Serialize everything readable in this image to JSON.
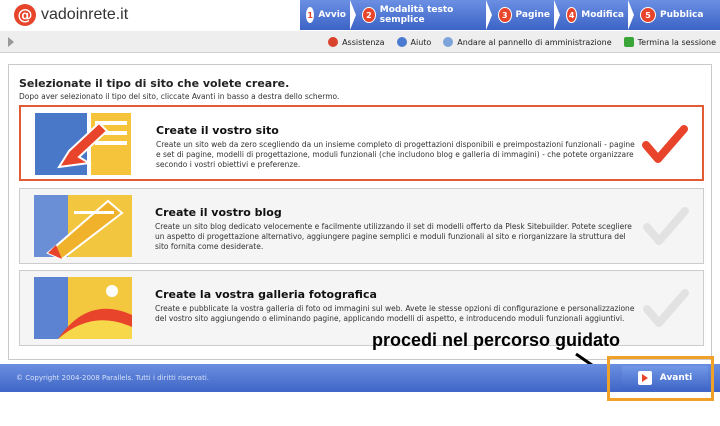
{
  "header": {
    "logo_text": "vadoinrete.it",
    "logo_glyph": "@",
    "nav": [
      {
        "label": "Avvio",
        "step": "1"
      },
      {
        "label": "Modalità testo semplice",
        "step": "2"
      },
      {
        "label": "Pagine",
        "step": "3"
      },
      {
        "label": "Modifica",
        "step": "4"
      },
      {
        "label": "Pubblica",
        "step": "5"
      }
    ]
  },
  "toolbar": {
    "links": [
      {
        "label": "Assistenza",
        "icon": "help-icon"
      },
      {
        "label": "Aiuto",
        "icon": "question-icon"
      },
      {
        "label": "Andare al pannello di amministrazione",
        "icon": "admin-panel-icon"
      },
      {
        "label": "Termina la sessione",
        "icon": "logout-icon"
      }
    ]
  },
  "main": {
    "heading": "Selezionate il tipo di sito che volete creare.",
    "subheading": "Dopo aver selezionato il tipo del sito, cliccate Avanti in basso a destra dello schermo.",
    "options": [
      {
        "title": "Create il vostro sito",
        "description": "Create un sito web da zero scegliendo da un insieme completo di progettazioni disponibili e preimpostazioni funzionali - pagine e set di pagine, modelli di progettazione, moduli funzionali (che includono blog e galleria di immagini) - che potete organizzare secondo i vostri obiettivi e preferenze.",
        "selected": true
      },
      {
        "title": "Create il vostro blog",
        "description": "Create un sito blog dedicato velocemente e facilmente utilizzando il set di modelli offerto da Plesk Sitebuilder. Potete scegliere un aspetto di progettazione alternativo, aggiungere pagine semplici e moduli funzionali al sito e riorganizzare la struttura del sito fornita come desiderate.",
        "selected": false
      },
      {
        "title": "Create la vostra galleria fotografica",
        "description": "Create e pubblicate la vostra galleria di foto od immagini sul web. Avete le stesse opzioni di configurazione e personalizzazione del vostro sito aggiungendo o eliminando pagine, applicando modelli di aspetto, e introducendo moduli funzionali aggiuntivi.",
        "selected": false
      }
    ]
  },
  "footer": {
    "copyright": "© Copyright 2004-2008 Parallels. Tutti i diritti riservati.",
    "next_label": "Avanti"
  },
  "annotation": {
    "text": "procedi nel percorso guidato"
  },
  "colors": {
    "header_blue": "#3a62c4",
    "accent_red": "#e8442c",
    "highlight_orange": "#f0a12a",
    "selected_border": "#e25b35"
  }
}
